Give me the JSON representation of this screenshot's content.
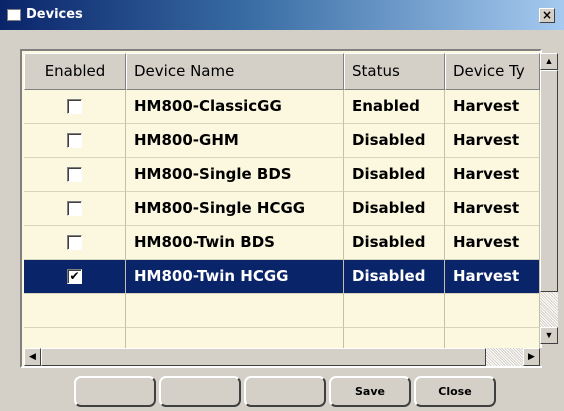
{
  "window": {
    "title": "Devices",
    "close_glyph": "×",
    "title_icon": "window-icon"
  },
  "grid": {
    "columns": [
      {
        "label": "Enabled"
      },
      {
        "label": "Device Name"
      },
      {
        "label": "Status"
      },
      {
        "label": "Device Ty"
      }
    ],
    "rows": [
      {
        "enabled": false,
        "name": "HM800-ClassicGG",
        "status": "Enabled",
        "type": "Harvest",
        "selected": false
      },
      {
        "enabled": false,
        "name": "HM800-GHM",
        "status": "Disabled",
        "type": "Harvest",
        "selected": false
      },
      {
        "enabled": false,
        "name": "HM800-Single BDS",
        "status": "Disabled",
        "type": "Harvest",
        "selected": false
      },
      {
        "enabled": false,
        "name": "HM800-Single HCGG",
        "status": "Disabled",
        "type": "Harvest",
        "selected": false
      },
      {
        "enabled": false,
        "name": "HM800-Twin BDS",
        "status": "Disabled",
        "type": "Harvest",
        "selected": false
      },
      {
        "enabled": true,
        "name": "HM800-Twin HCGG",
        "status": "Disabled",
        "type": "Harvest",
        "selected": true
      }
    ],
    "empty_rows": 2
  },
  "scrollbars": {
    "up_arrow": "▲",
    "down_arrow": "▼",
    "left_arrow": "◀",
    "right_arrow": "▶"
  },
  "toolbar": {
    "buttons": [
      "",
      "",
      "",
      "Save",
      "Close"
    ]
  },
  "colors": {
    "selection": "#0a246a",
    "grid_background": "#fcf8df",
    "title_gradient_start": "#0a246a"
  }
}
